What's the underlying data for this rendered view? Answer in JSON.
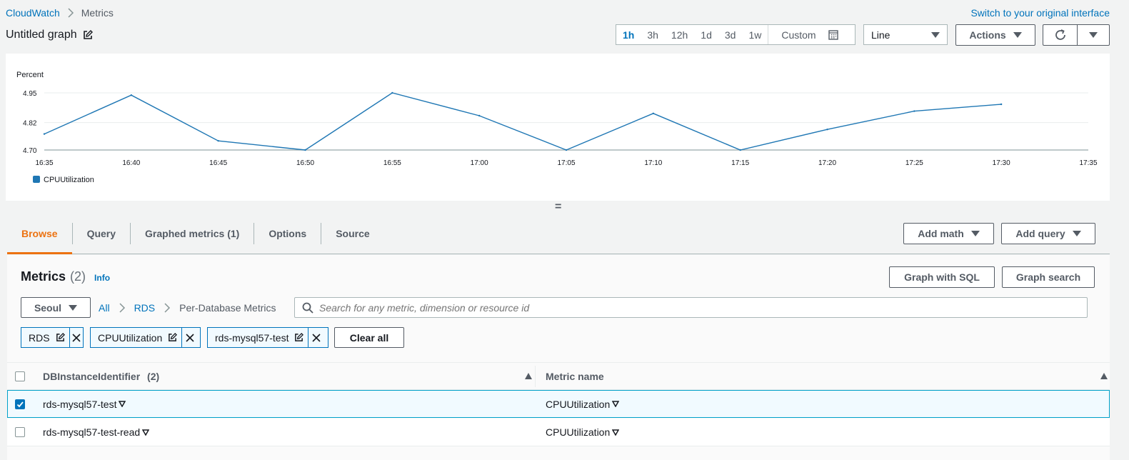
{
  "breadcrumb": {
    "root": "CloudWatch",
    "current": "Metrics"
  },
  "switch_link": "Switch to your original interface",
  "graph_title": "Untitled graph",
  "time_ranges": [
    "1h",
    "3h",
    "12h",
    "1d",
    "3d",
    "1w"
  ],
  "time_custom": "Custom",
  "view_select": "Line",
  "actions_label": "Actions",
  "chart_data": {
    "type": "line",
    "ylabel": "Percent",
    "yticks": [
      "4.70",
      "4.82",
      "4.95"
    ],
    "ylim": [
      4.7,
      4.95
    ],
    "xticks": [
      "16:35",
      "16:40",
      "16:45",
      "16:50",
      "16:55",
      "17:00",
      "17:05",
      "17:10",
      "17:15",
      "17:20",
      "17:25",
      "17:30",
      "17:35"
    ],
    "series": [
      {
        "name": "CPUUtilization",
        "color": "#1f77b4",
        "x": [
          "16:35",
          "16:40",
          "16:45",
          "16:50",
          "16:55",
          "17:00",
          "17:05",
          "17:10",
          "17:15",
          "17:20",
          "17:25",
          "17:30"
        ],
        "values": [
          4.77,
          4.94,
          4.74,
          4.7,
          4.95,
          4.85,
          4.7,
          4.86,
          4.7,
          4.79,
          4.87,
          4.9
        ]
      }
    ],
    "grid": true,
    "legend": "bottom-left"
  },
  "resize_handle": "=",
  "tabs": [
    "Browse",
    "Query",
    "Graphed metrics (1)",
    "Options",
    "Source"
  ],
  "add_math": "Add math",
  "add_query": "Add query",
  "metrics": {
    "title": "Metrics",
    "count": "(2)",
    "info": "Info"
  },
  "graph_sql": "Graph with SQL",
  "graph_search": "Graph search",
  "region": "Seoul",
  "path": {
    "all": "All",
    "rds": "RDS",
    "current": "Per-Database Metrics"
  },
  "search_placeholder": "Search for any metric, dimension or resource id",
  "chips": [
    "RDS",
    "CPUUtilization",
    "rds-mysql57-test"
  ],
  "clear_all": "Clear all",
  "table": {
    "col1": "DBInstanceIdentifier",
    "col1_count": "(2)",
    "col2": "Metric name",
    "rows": [
      {
        "id": "rds-mysql57-test",
        "metric": "CPUUtilization",
        "checked": true
      },
      {
        "id": "rds-mysql57-test-read",
        "metric": "CPUUtilization",
        "checked": false
      }
    ]
  }
}
